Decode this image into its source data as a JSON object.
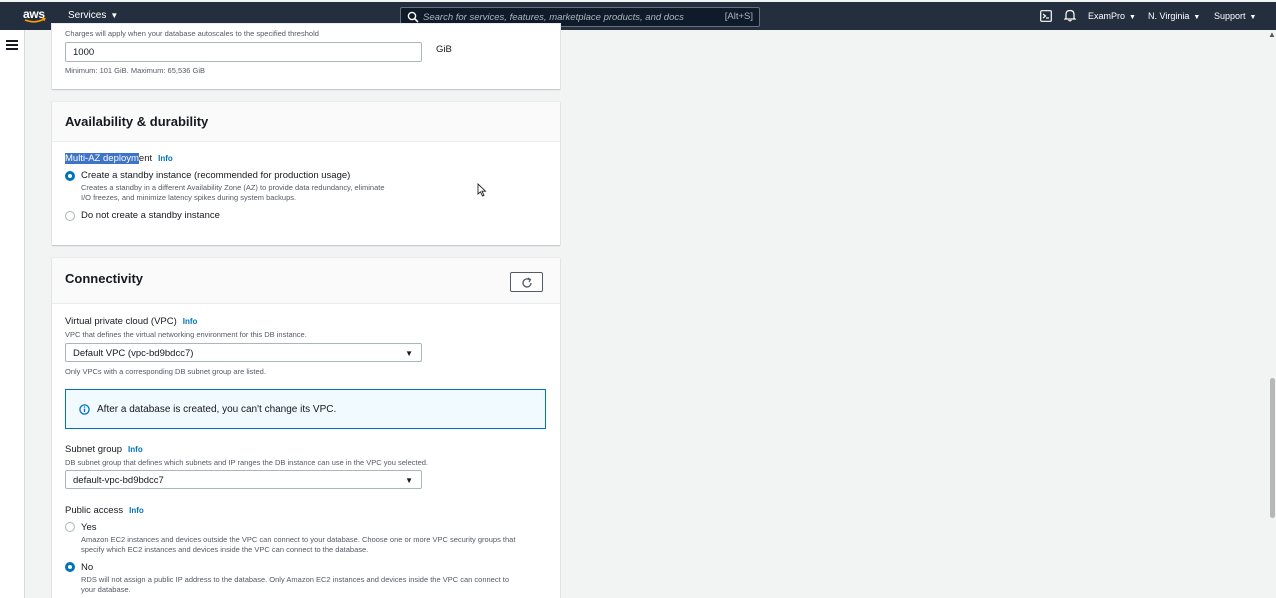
{
  "nav": {
    "logo": "aws",
    "services": "Services",
    "search_placeholder": "Search for services, features, marketplace products, and docs",
    "search_shortcut": "[Alt+S]",
    "account": "ExamPro",
    "region": "N. Virginia",
    "support": "Support"
  },
  "storage": {
    "charges_note": "Charges will apply when your database autoscales to the specified threshold",
    "threshold_value": "1000",
    "unit": "GiB",
    "hint": "Minimum: 101 GiB. Maximum: 65,536 GiB"
  },
  "availability": {
    "title": "Availability & durability",
    "field_label_selected": "Multi-AZ deploym",
    "field_label_rest": "ent",
    "info": "Info",
    "option1_title": "Create a standby instance (recommended for production usage)",
    "option1_desc_line1": "Creates a standby in a different Availability Zone (AZ) to provide data redundancy, eliminate",
    "option1_desc_line2": "I/O freezes, and minimize latency spikes during system backups.",
    "option2_title": "Do not create a standby instance"
  },
  "connectivity": {
    "title": "Connectivity",
    "vpc_label": "Virtual private cloud (VPC)",
    "vpc_info": "Info",
    "vpc_desc": "VPC that defines the virtual networking environment for this DB instance.",
    "vpc_value": "Default VPC (vpc-bd9bdcc7)",
    "vpc_hint": "Only VPCs with a corresponding DB subnet group are listed.",
    "alert": "After a database is created, you can't change its VPC.",
    "subnet_label": "Subnet group",
    "subnet_info": "Info",
    "subnet_desc": "DB subnet group that defines which subnets and IP ranges the DB instance can use in the VPC you selected.",
    "subnet_value": "default-vpc-bd9bdcc7",
    "public_label": "Public access",
    "public_info": "Info",
    "yes_title": "Yes",
    "yes_desc_line1": "Amazon EC2 instances and devices outside the VPC can connect to your database. Choose one or more VPC security groups that",
    "yes_desc_line2": "specify which EC2 instances and devices inside the VPC can connect to the database.",
    "no_title": "No",
    "no_desc_line1": "RDS will not assign a public IP address to the database. Only Amazon EC2 instances and devices inside the VPC can connect to",
    "no_desc_line2": "your database."
  },
  "colors": {
    "nav_bg": "#232f3e",
    "link": "#0073bb",
    "selection": "#3f73c7"
  }
}
